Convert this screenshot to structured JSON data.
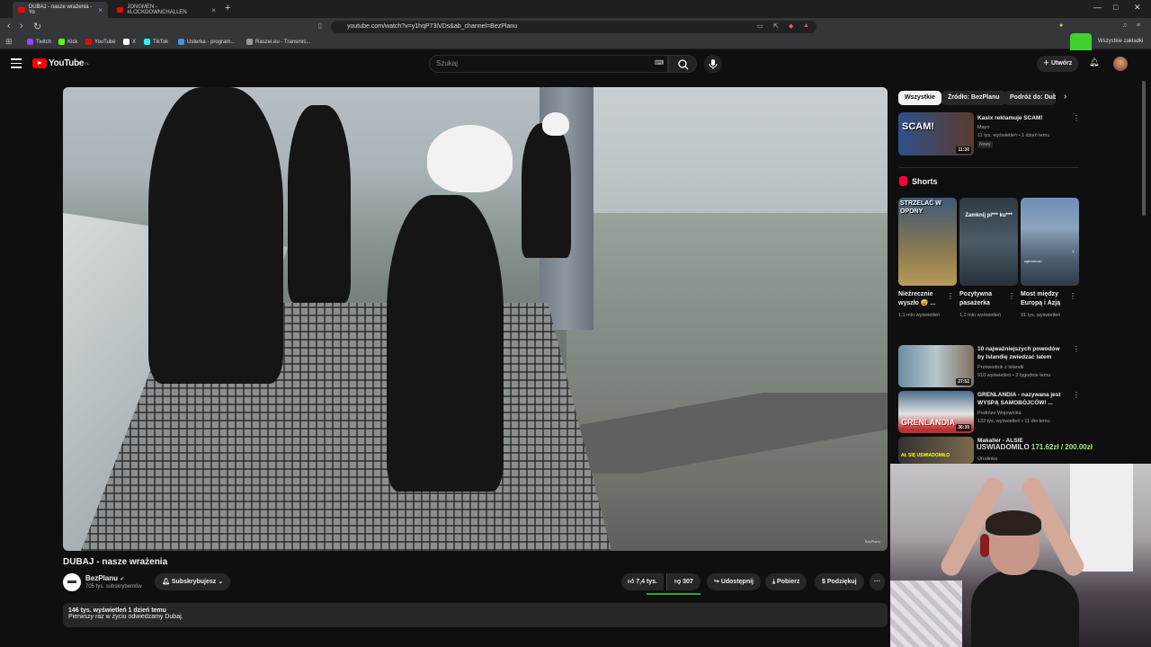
{
  "browser": {
    "tabs": [
      {
        "label": "DUBAJ - nasze wrażenia - Yo"
      },
      {
        "label": "JONGMEN - #LOCKDOWNCHALLEN"
      }
    ],
    "new_tab": "+",
    "url": "youtube.com/watch?v=y1hqP73iVDs&ab_channel=BezPlanu",
    "bookmarks": [
      {
        "label": "Twitch",
        "color": "#9146ff"
      },
      {
        "label": "Kick",
        "color": "#53fc18"
      },
      {
        "label": "YouTube",
        "color": "#ff0000"
      },
      {
        "label": "X",
        "color": "#ffffff"
      },
      {
        "label": "TikTok",
        "color": "#25f4ee"
      },
      {
        "label": "Usterka - program...",
        "color": "#4a90e2"
      },
      {
        "label": "Raszei.eu - Transmis...",
        "color": "#999999"
      }
    ],
    "all_bookmarks": "Wszystkie zakładki"
  },
  "header": {
    "logo_text": "YouTube",
    "logo_region": "PL",
    "search_placeholder": "Szukaj",
    "create_label": "Utwórz"
  },
  "video": {
    "title": "DUBAJ - nasze wrażenia",
    "watermark": "BezPlanu",
    "channel": {
      "name": "BezPlanu",
      "subscribers": "705 tys. subskrybentów",
      "subscribe_label": "Subskrybujesz"
    },
    "likes": "7,4 tys.",
    "dislikes": "307",
    "share_label": "Udostępnij",
    "download_label": "Pobierz",
    "thanks_label": "Podziękuj",
    "more": "···",
    "description": {
      "meta": "146 tys. wyświetleń  1 dzień temu",
      "text": "Pierwszy raz w życiu odwiedzamy Dubaj."
    }
  },
  "sidebar": {
    "chips": [
      {
        "label": "Wszystkie"
      },
      {
        "label": "Źródło: BezPlanu"
      },
      {
        "label": "Podróż do: Dubaj"
      }
    ],
    "chip_next": "›",
    "top_video": {
      "title": "Kasix reklamuje SCAM!",
      "channel": "Mayo",
      "meta": "11 tys. wyświetleń • 1 dzień temu",
      "badge": "Nowy",
      "duration": "11:30",
      "thumb_text": "SCAM!"
    },
    "shorts_title": "Shorts",
    "shorts": [
      {
        "title": "Nieźrecznie wyszło 😅 ...",
        "views": "1,1 mln wyświetleń",
        "thumb_text": "STRZELAĆ W OPONY"
      },
      {
        "title": "Pozytywna pasażerka",
        "views": "1,2 mln wyświetleń",
        "thumb_text": "Zamknij pi*** ku***"
      },
      {
        "title": "Most między Europą i Azją",
        "views": "91 tys. wyświetleń",
        "thumb_text": "ogłomeraci"
      }
    ],
    "videos": [
      {
        "title": "10 najważniejszych powodów by Islandię zwiedzać latem",
        "channel": "Przewodnik z Islandii",
        "meta": "910 wyświetleń • 3 tygodnie temu",
        "duration": "27:52"
      },
      {
        "title": "GRENLANDIA - nazywana jest WYSPĄ SAMOBÓJCÓW! ...",
        "channel": "Podróże Wojownika",
        "meta": "132 tys. wyświetleń • 11 dni temu",
        "duration": "36:39",
        "thumb_text": "GRENLANDIA"
      },
      {
        "title": "Makaller - ALSIE",
        "channel": "Urodinka",
        "meta": "",
        "thumb_text": "AŁ SIĘ USWIADOMIŁO"
      }
    ]
  },
  "overlay": {
    "donation_label": "USWIADOMILO",
    "donation_value": "171.62zł / 200.00zł"
  },
  "colors": {
    "accent": "#ff0000",
    "like_bar": "#2ba640",
    "donation": "#a6f07a"
  }
}
